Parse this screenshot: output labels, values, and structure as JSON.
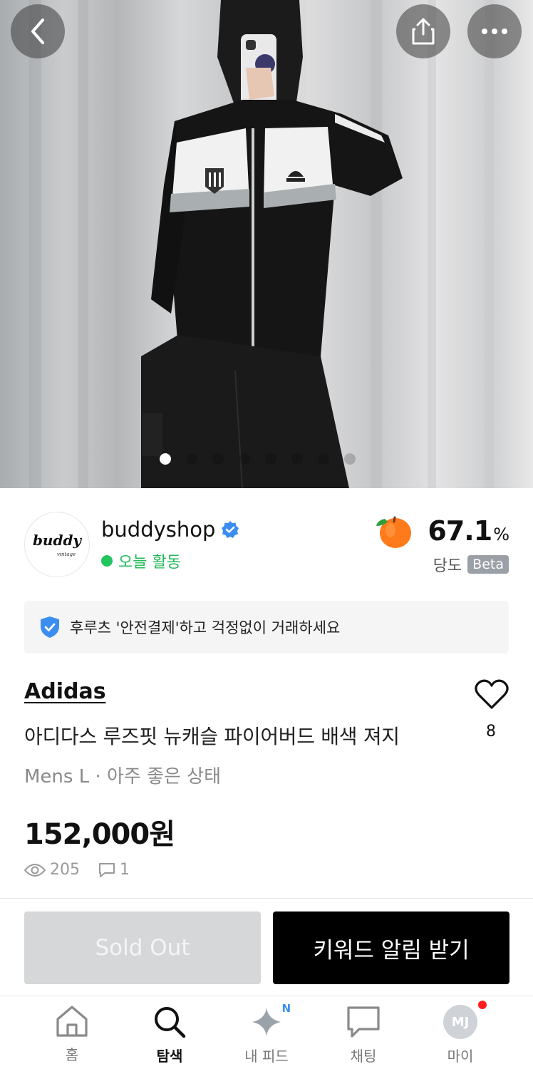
{
  "hero": {
    "image_count": 8,
    "active_index": 0
  },
  "seller": {
    "avatar_text": "buddy",
    "avatar_subtext": "vintage",
    "name": "buddyshop",
    "status": "오늘 활동",
    "rating_value": "67.1",
    "rating_unit": "%",
    "rating_label": "당도",
    "rating_badge": "Beta"
  },
  "notice": {
    "text": "후루츠 '안전결제'하고 걱정없이 거래하세요"
  },
  "product": {
    "brand": "Adidas",
    "title": "아디다스 루즈핏 뉴캐슬 파이어버드 배색 져지",
    "subtitle": "Mens L · 아주 좋은 상태",
    "price": "152,000원",
    "likes": "8",
    "views": "205",
    "comments": "1"
  },
  "actions": {
    "sold_out_label": "Sold Out",
    "keyword_alert_label": "키워드 알림 받기"
  },
  "nav": {
    "home": "홈",
    "search": "탐색",
    "feed": "내 피드",
    "feed_badge": "N",
    "chat": "채팅",
    "my": "마이",
    "my_initials": "MJ"
  },
  "colors": {
    "online_green": "#22c55e",
    "verified_blue": "#3b8ef0",
    "notification_red": "#ff1f1f"
  }
}
